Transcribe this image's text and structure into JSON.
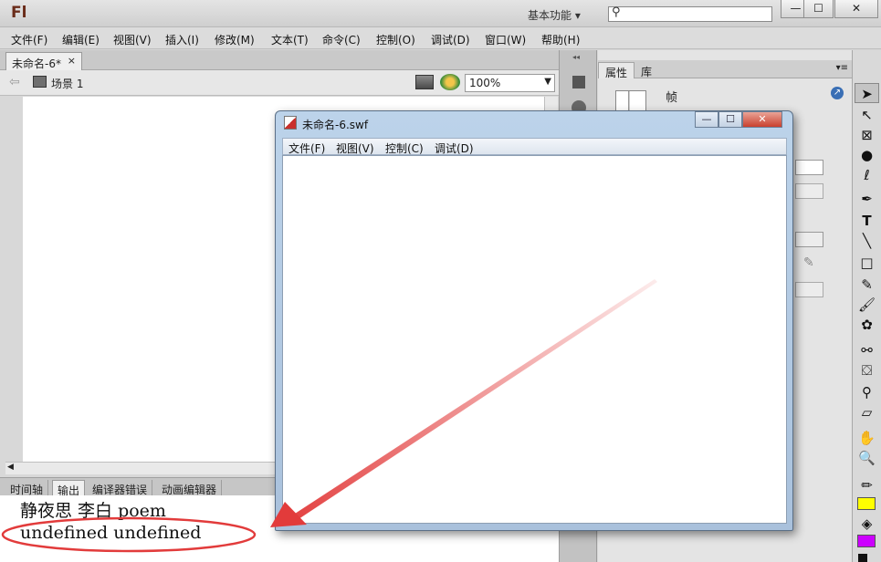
{
  "app": {
    "logo": "Fl",
    "workspace": "基本功能",
    "workspace_arrow": "▾",
    "search_icon": "⚲",
    "window_controls": {
      "minimize": "—",
      "maximize": "☐",
      "close": "✕"
    }
  },
  "menubar": [
    "文件(F)",
    "编辑(E)",
    "视图(V)",
    "插入(I)",
    "修改(M)",
    "文本(T)",
    "命令(C)",
    "控制(O)",
    "调试(D)",
    "窗口(W)",
    "帮助(H)"
  ],
  "document": {
    "tab_title": "未命名-6*",
    "tab_close": "×",
    "scene_label": "场景 1",
    "zoom": "100%"
  },
  "output_panel": {
    "tabs": [
      "时间轴",
      "输出",
      "编译器错误",
      "动画编辑器"
    ],
    "active_tab": "输出",
    "lines": [
      "静夜思 李白 poem",
      "undefined undefined"
    ]
  },
  "properties_panel": {
    "tabs": [
      "属性",
      "库"
    ],
    "frame_label": "帧"
  },
  "swf_window": {
    "title": "未命名-6.swf",
    "menu": [
      "文件(F)",
      "视图(V)",
      "控制(C)",
      "调试(D)"
    ],
    "controls": {
      "minimize": "—",
      "maximize": "☐",
      "close": "✕"
    }
  },
  "annotation": {
    "color": "#e23b3b"
  }
}
